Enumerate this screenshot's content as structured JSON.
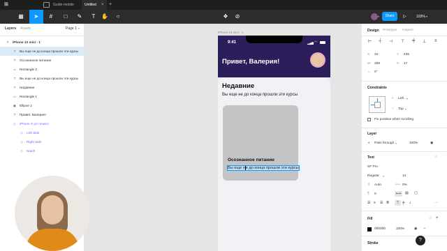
{
  "tabs": [
    {
      "label": "Guide-mobile"
    },
    {
      "label": "Untitled"
    }
  ],
  "toolbar": {
    "menu_icon": "figma-menu-icon",
    "share_label": "Share",
    "zoom": "103%"
  },
  "left_panel": {
    "tab_layers": "Layers",
    "tab_assets": "Assets",
    "page": "Page 1",
    "layers": [
      {
        "label": "iPhone 13 mini - 1",
        "icon": "#",
        "indent": 0,
        "selected": false,
        "purple": false
      },
      {
        "label": "Вы еще не до конца прошли эти курсы",
        "icon": "T",
        "indent": 1,
        "selected": true,
        "purple": false
      },
      {
        "label": "Осознанное питание",
        "icon": "T",
        "indent": 1,
        "selected": false,
        "purple": false
      },
      {
        "label": "Rectangle 2",
        "icon": "▭",
        "indent": 1,
        "selected": false,
        "purple": false
      },
      {
        "label": "Вы еще не до конца прошли эти курсы",
        "icon": "T",
        "indent": 1,
        "selected": false,
        "purple": false
      },
      {
        "label": "Недавние",
        "icon": "T",
        "indent": 1,
        "selected": false,
        "purple": false
      },
      {
        "label": "Rectangle 1",
        "icon": "▭",
        "indent": 1,
        "selected": false,
        "purple": false
      },
      {
        "label": "Ellipse 1",
        "icon": "▣",
        "indent": 1,
        "selected": false,
        "purple": false
      },
      {
        "label": "Привет, Валерия!",
        "icon": "T",
        "indent": 1,
        "selected": false,
        "purple": false
      },
      {
        "label": "iPhone X (or newer)",
        "icon": "◇",
        "indent": 1,
        "selected": false,
        "purple": true
      },
      {
        "label": "Left Side",
        "icon": "◇",
        "indent": 2,
        "selected": false,
        "purple": true
      },
      {
        "label": "Right Side",
        "icon": "◇",
        "indent": 2,
        "selected": false,
        "purple": true
      },
      {
        "label": "Notch",
        "icon": "◇",
        "indent": 2,
        "selected": false,
        "purple": true
      }
    ]
  },
  "canvas": {
    "frame_label": "iPhone 13 mini - 1",
    "status_time": "9:41",
    "greeting": "Привет, Валерия!",
    "section_title": "Недавние",
    "section_subtitle": "Вы еще не до конца прошли эти курсы",
    "card_title": "Осознанное питание",
    "card_subtitle_editing": "Вы еще н",
    "card_subtitle_rest": "е до конца прошли эти курсы",
    "colors": {
      "header": "#2c1e5b",
      "card": "#c4c4c4",
      "selection": "#0d99ff"
    }
  },
  "right_panel": {
    "tab_design": "Design",
    "tab_prototype": "Prototype",
    "tab_inspect": "Inspect",
    "x_label": "X",
    "x": "34",
    "y_label": "Y",
    "y": "435",
    "w_label": "W",
    "w": "268",
    "h_label": "H",
    "h": "17",
    "rotation": "0°",
    "constraints_title": "Constraints",
    "constraint_h": "Left",
    "constraint_v": "Top",
    "fix_position": "Fix position when scrolling",
    "layer_title": "Layer",
    "blend_mode": "Pass through",
    "layer_opacity": "100%",
    "text_title": "Text",
    "font_family": "SF Pro",
    "font_weight": "Regular",
    "font_size": "14",
    "line_height": "Auto",
    "letter_spacing": "0%",
    "paragraph_spacing": "0",
    "fill_title": "Fill",
    "fill_hex": "000000",
    "fill_opacity": "100%",
    "stroke_title": "Stroke",
    "help": "?"
  }
}
